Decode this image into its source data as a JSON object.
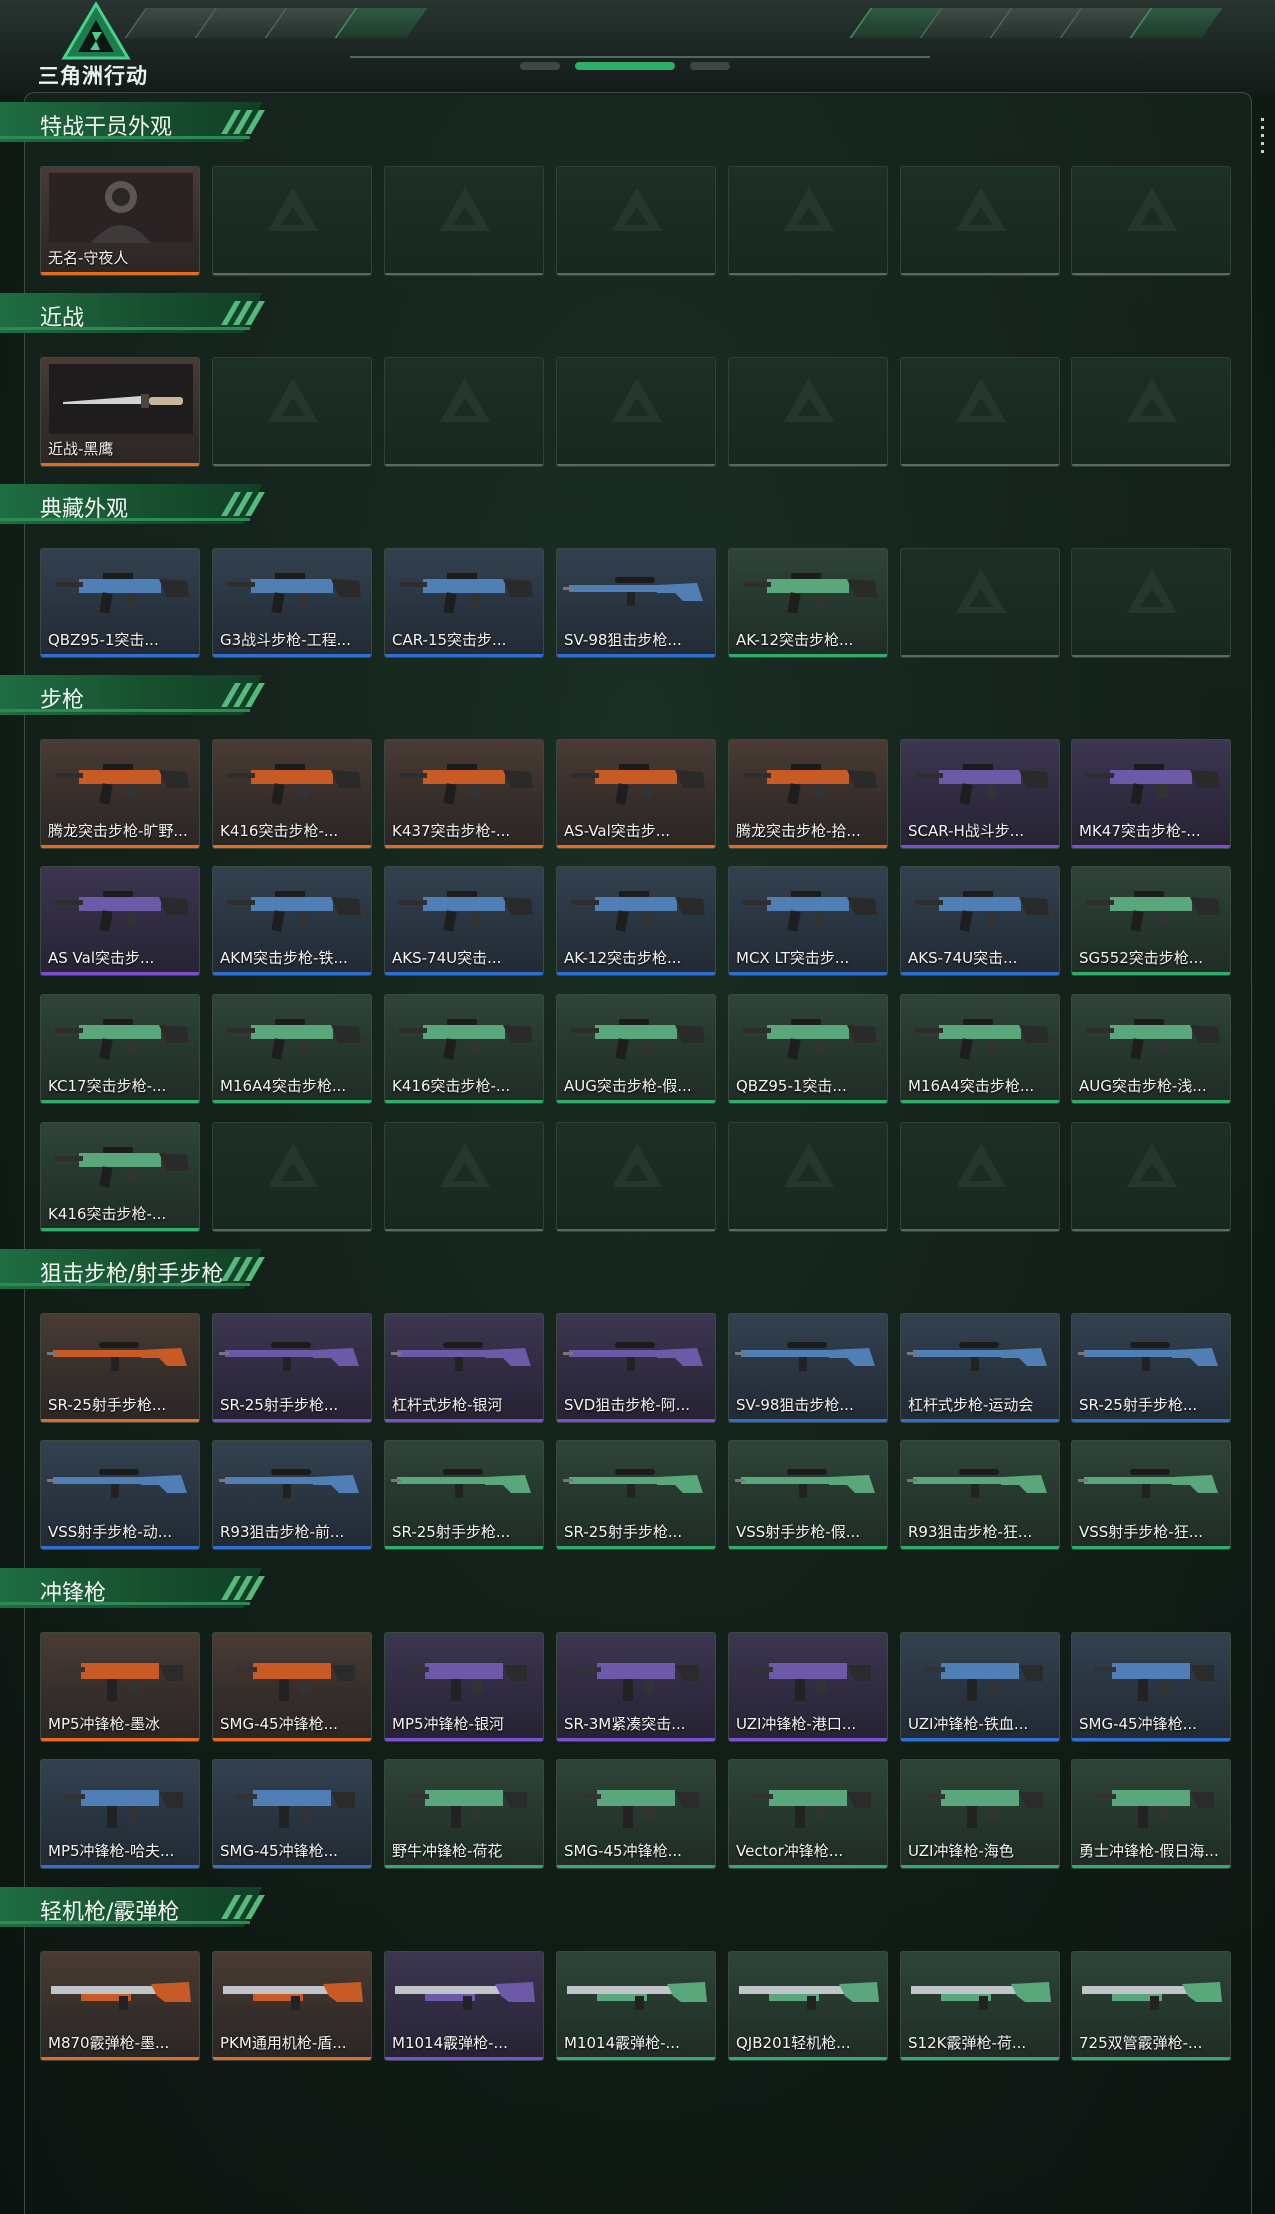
{
  "app": {
    "title": "三角洲行动",
    "colors": {
      "accent": "#2c8a55",
      "orange": "#e56a1f",
      "purple": "#7b4fd1",
      "blue": "#2e6fd6",
      "green": "#2fae6a",
      "empty": "#5b6a63"
    }
  },
  "sections": [
    {
      "title": "特战干员外观",
      "rows": [
        [
          {
            "label": "无名-守夜人",
            "rarity": "orange",
            "icon": "operator-portrait-icon"
          },
          {
            "label": "",
            "rarity": "empty"
          },
          {
            "label": "",
            "rarity": "empty"
          },
          {
            "label": "",
            "rarity": "empty"
          },
          {
            "label": "",
            "rarity": "empty"
          },
          {
            "label": "",
            "rarity": "empty"
          },
          {
            "label": "",
            "rarity": "empty"
          }
        ]
      ]
    },
    {
      "title": "近战",
      "rows": [
        [
          {
            "label": "近战-黑鹰",
            "rarity": "orange",
            "icon": "knife-icon"
          },
          {
            "label": "",
            "rarity": "empty"
          },
          {
            "label": "",
            "rarity": "empty"
          },
          {
            "label": "",
            "rarity": "empty"
          },
          {
            "label": "",
            "rarity": "empty"
          },
          {
            "label": "",
            "rarity": "empty"
          },
          {
            "label": "",
            "rarity": "empty"
          }
        ]
      ]
    },
    {
      "title": "典藏外观",
      "rows": [
        [
          {
            "label": "QBZ95-1突击...",
            "rarity": "blue",
            "icon": "rifle-icon"
          },
          {
            "label": "G3战斗步枪-工程...",
            "rarity": "blue",
            "icon": "rifle-icon"
          },
          {
            "label": "CAR-15突击步...",
            "rarity": "blue",
            "icon": "rifle-icon"
          },
          {
            "label": "SV-98狙击步枪...",
            "rarity": "blue",
            "icon": "sniper-icon"
          },
          {
            "label": "AK-12突击步枪...",
            "rarity": "green",
            "icon": "rifle-icon"
          },
          {
            "label": "",
            "rarity": "empty"
          },
          {
            "label": "",
            "rarity": "empty"
          }
        ]
      ]
    },
    {
      "title": "步枪",
      "rows": [
        [
          {
            "label": "腾龙突击步枪-旷野...",
            "rarity": "orange",
            "icon": "rifle-icon"
          },
          {
            "label": "K416突击步枪-...",
            "rarity": "orange",
            "icon": "rifle-icon"
          },
          {
            "label": "K437突击步枪-...",
            "rarity": "orange",
            "icon": "rifle-icon"
          },
          {
            "label": "AS-Val突击步...",
            "rarity": "orange",
            "icon": "rifle-icon"
          },
          {
            "label": "腾龙突击步枪-拾...",
            "rarity": "orange",
            "icon": "rifle-icon"
          },
          {
            "label": "SCAR-H战斗步...",
            "rarity": "purple",
            "icon": "rifle-icon"
          },
          {
            "label": "MK47突击步枪-...",
            "rarity": "purple",
            "icon": "rifle-icon"
          }
        ],
        [
          {
            "label": "AS Val突击步...",
            "rarity": "purple",
            "icon": "rifle-icon"
          },
          {
            "label": "AKM突击步枪-铁...",
            "rarity": "blue",
            "icon": "rifle-icon"
          },
          {
            "label": "AKS-74U突击...",
            "rarity": "blue",
            "icon": "rifle-icon"
          },
          {
            "label": "AK-12突击步枪...",
            "rarity": "blue",
            "icon": "rifle-icon"
          },
          {
            "label": "MCX LT突击步...",
            "rarity": "blue",
            "icon": "rifle-icon"
          },
          {
            "label": "AKS-74U突击...",
            "rarity": "blue",
            "icon": "rifle-icon"
          },
          {
            "label": "SG552突击步枪...",
            "rarity": "green",
            "icon": "rifle-icon"
          }
        ],
        [
          {
            "label": "KC17突击步枪-...",
            "rarity": "green",
            "icon": "rifle-icon"
          },
          {
            "label": "M16A4突击步枪...",
            "rarity": "green",
            "icon": "rifle-icon"
          },
          {
            "label": "K416突击步枪-...",
            "rarity": "green",
            "icon": "rifle-icon"
          },
          {
            "label": "AUG突击步枪-假...",
            "rarity": "green",
            "icon": "rifle-icon"
          },
          {
            "label": "QBZ95-1突击...",
            "rarity": "green",
            "icon": "rifle-icon"
          },
          {
            "label": "M16A4突击步枪...",
            "rarity": "green",
            "icon": "rifle-icon"
          },
          {
            "label": "AUG突击步枪-浅...",
            "rarity": "green",
            "icon": "rifle-icon"
          }
        ],
        [
          {
            "label": "K416突击步枪-...",
            "rarity": "green",
            "icon": "rifle-icon"
          },
          {
            "label": "",
            "rarity": "empty"
          },
          {
            "label": "",
            "rarity": "empty"
          },
          {
            "label": "",
            "rarity": "empty"
          },
          {
            "label": "",
            "rarity": "empty"
          },
          {
            "label": "",
            "rarity": "empty"
          },
          {
            "label": "",
            "rarity": "empty"
          }
        ]
      ]
    },
    {
      "title": "狙击步枪/射手步枪",
      "rows": [
        [
          {
            "label": "SR-25射手步枪...",
            "rarity": "orange",
            "icon": "sniper-icon"
          },
          {
            "label": "SR-25射手步枪...",
            "rarity": "purple",
            "icon": "sniper-icon"
          },
          {
            "label": "杠杆式步枪-银河",
            "rarity": "purple",
            "icon": "sniper-icon"
          },
          {
            "label": "SVD狙击步枪-阿...",
            "rarity": "purple",
            "icon": "sniper-icon"
          },
          {
            "label": "SV-98狙击步枪...",
            "rarity": "blue",
            "icon": "sniper-icon"
          },
          {
            "label": "杠杆式步枪-运动会",
            "rarity": "blue",
            "icon": "sniper-icon"
          },
          {
            "label": "SR-25射手步枪...",
            "rarity": "blue",
            "icon": "sniper-icon"
          }
        ],
        [
          {
            "label": "VSS射手步枪-动...",
            "rarity": "blue",
            "icon": "sniper-icon"
          },
          {
            "label": "R93狙击步枪-前...",
            "rarity": "blue",
            "icon": "sniper-icon"
          },
          {
            "label": "SR-25射手步枪...",
            "rarity": "green",
            "icon": "sniper-icon"
          },
          {
            "label": "SR-25射手步枪...",
            "rarity": "green",
            "icon": "sniper-icon"
          },
          {
            "label": "VSS射手步枪-假...",
            "rarity": "green",
            "icon": "sniper-icon"
          },
          {
            "label": "R93狙击步枪-狂...",
            "rarity": "green",
            "icon": "sniper-icon"
          },
          {
            "label": "VSS射手步枪-狂...",
            "rarity": "green",
            "icon": "sniper-icon"
          }
        ]
      ]
    },
    {
      "title": "冲锋枪",
      "rows": [
        [
          {
            "label": "MP5冲锋枪-墨冰",
            "rarity": "orange",
            "icon": "smg-icon"
          },
          {
            "label": "SMG-45冲锋枪...",
            "rarity": "orange",
            "icon": "smg-icon"
          },
          {
            "label": "MP5冲锋枪-银河",
            "rarity": "purple",
            "icon": "smg-icon"
          },
          {
            "label": "SR-3M紧凑突击...",
            "rarity": "purple",
            "icon": "smg-icon"
          },
          {
            "label": "UZI冲锋枪-港口...",
            "rarity": "purple",
            "icon": "smg-icon"
          },
          {
            "label": "UZI冲锋枪-铁血...",
            "rarity": "blue",
            "icon": "smg-icon"
          },
          {
            "label": "SMG-45冲锋枪...",
            "rarity": "blue",
            "icon": "smg-icon"
          }
        ],
        [
          {
            "label": "MP5冲锋枪-哈夫...",
            "rarity": "blue",
            "icon": "smg-icon"
          },
          {
            "label": "SMG-45冲锋枪...",
            "rarity": "blue",
            "icon": "smg-icon"
          },
          {
            "label": "野牛冲锋枪-荷花",
            "rarity": "green",
            "icon": "smg-icon"
          },
          {
            "label": "SMG-45冲锋枪...",
            "rarity": "green",
            "icon": "smg-icon"
          },
          {
            "label": "Vector冲锋枪...",
            "rarity": "green",
            "icon": "smg-icon"
          },
          {
            "label": "UZI冲锋枪-海色",
            "rarity": "green",
            "icon": "smg-icon"
          },
          {
            "label": "勇士冲锋枪-假日海...",
            "rarity": "green",
            "icon": "smg-icon"
          }
        ]
      ]
    },
    {
      "title": "轻机枪/霰弹枪",
      "rows": [
        [
          {
            "label": "M870霰弹枪-墨...",
            "rarity": "orange",
            "icon": "shotgun-icon"
          },
          {
            "label": "PKM通用机枪-盾...",
            "rarity": "orange",
            "icon": "lmg-icon"
          },
          {
            "label": "M1014霰弹枪-...",
            "rarity": "purple",
            "icon": "shotgun-icon"
          },
          {
            "label": "M1014霰弹枪-...",
            "rarity": "green",
            "icon": "shotgun-icon"
          },
          {
            "label": "QJB201轻机枪...",
            "rarity": "green",
            "icon": "lmg-icon"
          },
          {
            "label": "S12K霰弹枪-荷...",
            "rarity": "green",
            "icon": "shotgun-icon"
          },
          {
            "label": "725双管霰弹枪-...",
            "rarity": "green",
            "icon": "shotgun-icon"
          }
        ]
      ]
    }
  ]
}
